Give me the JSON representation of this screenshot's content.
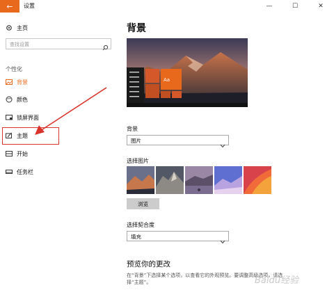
{
  "window": {
    "title": "设置",
    "back_glyph": "←",
    "minimize_glyph": "—",
    "maximize_glyph": "☐",
    "close_glyph": "✕"
  },
  "sidebar": {
    "home_label": "主页",
    "search_placeholder": "查找设置",
    "section_label": "个性化",
    "items": [
      {
        "label": "背景",
        "icon": "background-icon",
        "active": true
      },
      {
        "label": "颜色",
        "icon": "palette-icon",
        "active": false
      },
      {
        "label": "锁屏界面",
        "icon": "lock-screen-icon",
        "active": false
      },
      {
        "label": "主题",
        "icon": "theme-icon",
        "active": false
      },
      {
        "label": "开始",
        "icon": "start-icon",
        "active": false
      },
      {
        "label": "任务栏",
        "icon": "taskbar-icon",
        "active": false
      }
    ]
  },
  "main": {
    "heading": "背景",
    "preview_tile_text": "Aa",
    "background_label": "背景",
    "background_value": "图片",
    "choose_picture_label": "选择图片",
    "browse_label": "浏览",
    "fit_label": "选择契合度",
    "fit_value": "填充",
    "preview_title": "预览你的更改",
    "preview_desc": "在“背景”下选择某个选项，以查看它的外观预览。要调整高级选项，请选择“主题”。"
  },
  "watermark_text": "Baidu经验",
  "colors": {
    "accent": "#e8681c",
    "annotation": "#d9342b"
  }
}
